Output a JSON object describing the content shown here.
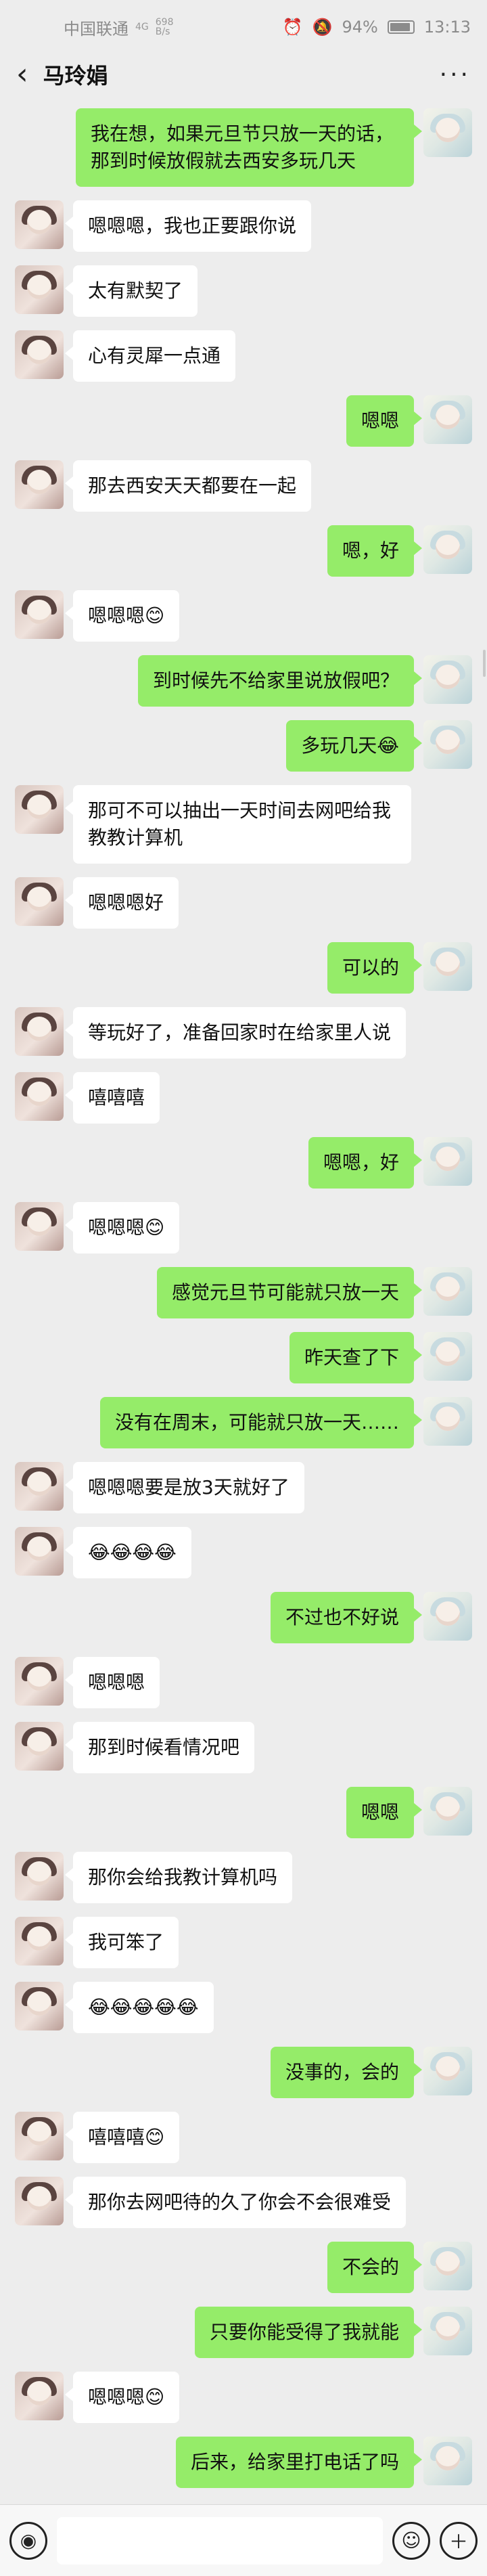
{
  "status_bar": {
    "carrier": "中国联通",
    "network": "4G",
    "data_speed_value": "698",
    "data_speed_unit": "B/s",
    "battery": "94%",
    "time": "13:13",
    "icons": [
      "signal-icon",
      "alarm-icon",
      "mute-icon",
      "battery-icon"
    ]
  },
  "header": {
    "title": "马玲娟",
    "back_icon": "chevron-left-icon",
    "more_icon": "more-icon"
  },
  "messages": [
    {
      "from": "me",
      "text": "我在想，如果元旦节只放一天的话，那到时候放假就去西安多玩几天"
    },
    {
      "from": "other",
      "text": "嗯嗯嗯，我也正要跟你说"
    },
    {
      "from": "other",
      "text": "太有默契了"
    },
    {
      "from": "other",
      "text": "心有灵犀一点通"
    },
    {
      "from": "me",
      "text": "嗯嗯"
    },
    {
      "from": "other",
      "text": "那去西安天天都要在一起"
    },
    {
      "from": "me",
      "text": "嗯，好"
    },
    {
      "from": "other",
      "text": "嗯嗯嗯😊"
    },
    {
      "from": "me",
      "text": "到时候先不给家里说放假吧？"
    },
    {
      "from": "me",
      "text": "多玩几天😂"
    },
    {
      "from": "other",
      "text": "那可不可以抽出一天时间去网吧给我教教计算机"
    },
    {
      "from": "other",
      "text": "嗯嗯嗯好"
    },
    {
      "from": "me",
      "text": "可以的"
    },
    {
      "from": "other",
      "text": "等玩好了，准备回家时在给家里人说"
    },
    {
      "from": "other",
      "text": "嘻嘻嘻"
    },
    {
      "from": "me",
      "text": "嗯嗯，好"
    },
    {
      "from": "other",
      "text": "嗯嗯嗯😊"
    },
    {
      "from": "me",
      "text": "感觉元旦节可能就只放一天"
    },
    {
      "from": "me",
      "text": "昨天查了下"
    },
    {
      "from": "me",
      "text": "没有在周末，可能就只放一天……"
    },
    {
      "from": "other",
      "text": "嗯嗯嗯要是放3天就好了"
    },
    {
      "from": "other",
      "text": "😂😂😂😂"
    },
    {
      "from": "me",
      "text": "不过也不好说"
    },
    {
      "from": "other",
      "text": "嗯嗯嗯"
    },
    {
      "from": "other",
      "text": "那到时候看情况吧"
    },
    {
      "from": "me",
      "text": "嗯嗯"
    },
    {
      "from": "other",
      "text": "那你会给我教计算机吗"
    },
    {
      "from": "other",
      "text": "我可笨了"
    },
    {
      "from": "other",
      "text": "😂😂😂😂😂"
    },
    {
      "from": "me",
      "text": "没事的，会的"
    },
    {
      "from": "other",
      "text": "嘻嘻嘻😊"
    },
    {
      "from": "other",
      "text": "那你去网吧待的久了你会不会很难受"
    },
    {
      "from": "me",
      "text": "不会的"
    },
    {
      "from": "me",
      "text": "只要你能受得了我就能"
    },
    {
      "from": "other",
      "text": "嗯嗯嗯😊"
    },
    {
      "from": "me",
      "text": "后来，给家里打电话了吗"
    }
  ],
  "input_bar": {
    "voice_icon": "voice-icon",
    "emoji_icon": "emoji-icon",
    "plus_icon": "plus-icon",
    "placeholder": ""
  }
}
